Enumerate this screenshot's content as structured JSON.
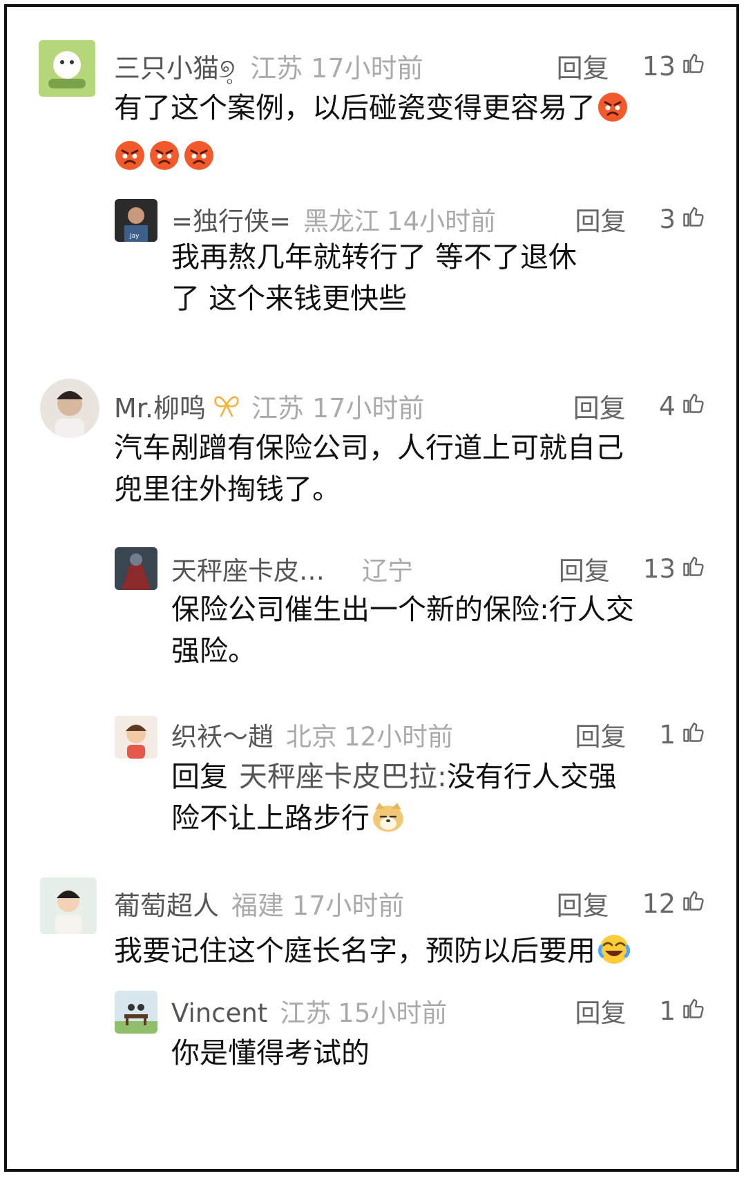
{
  "comments": [
    {
      "user": "三只小猫୭̥",
      "location": "江苏",
      "time": "17小时前",
      "reply_label": "回复",
      "likes": "13",
      "text": "有了这个案例，以后碰瓷变得更容易了",
      "emojis": [
        "angry-face",
        "angry-face",
        "angry-face",
        "angry-face"
      ],
      "replies": [
        {
          "user": "=独行侠=",
          "location": "黑龙江",
          "time": "14小时前",
          "reply_label": "回复",
          "likes": "3",
          "text_lines": [
            "我再熬几年就转行了 等不了退休",
            "了 这个来钱更快些"
          ]
        }
      ]
    },
    {
      "user": "Mr.柳鸣",
      "location": "江苏",
      "time": "17小时前",
      "reply_label": "回复",
      "likes": "4",
      "text_lines": [
        "汽车剐蹭有保险公司，人行道上可就自己",
        "兜里往外掏钱了。"
      ],
      "replies": [
        {
          "user": "天秤座卡皮…",
          "location": "辽宁",
          "time": "",
          "reply_label": "回复",
          "likes": "13",
          "text_lines": [
            "保险公司催生出一个新的保险:行人交",
            "强险。"
          ]
        },
        {
          "user": "织袄～趙",
          "location": "北京",
          "time": "12小时前",
          "reply_label": "回复",
          "likes": "1",
          "reply_to_label": "回复",
          "reply_to_user": "天秤座卡皮巴拉:",
          "text_lines": [
            "没有行人交强",
            "险不让上路步行"
          ],
          "emoji": "doge-face"
        }
      ]
    },
    {
      "user": "葡萄超人",
      "location": "福建",
      "time": "17小时前",
      "reply_label": "回复",
      "likes": "12",
      "text": "我要记住这个庭长名字，预防以后要用",
      "emoji": "laugh-cry-face",
      "replies": [
        {
          "user": "Vincent",
          "location": "江苏",
          "time": "15小时前",
          "reply_label": "回复",
          "likes": "1",
          "text": "你是懂得考试的"
        }
      ]
    }
  ],
  "colors": {
    "username": "#555555",
    "meta": "#aaaaaa",
    "text": "#111111",
    "action": "#666666"
  },
  "icons": {
    "like": "thumbs-up-icon",
    "badge": "ribbon-badge-icon"
  }
}
